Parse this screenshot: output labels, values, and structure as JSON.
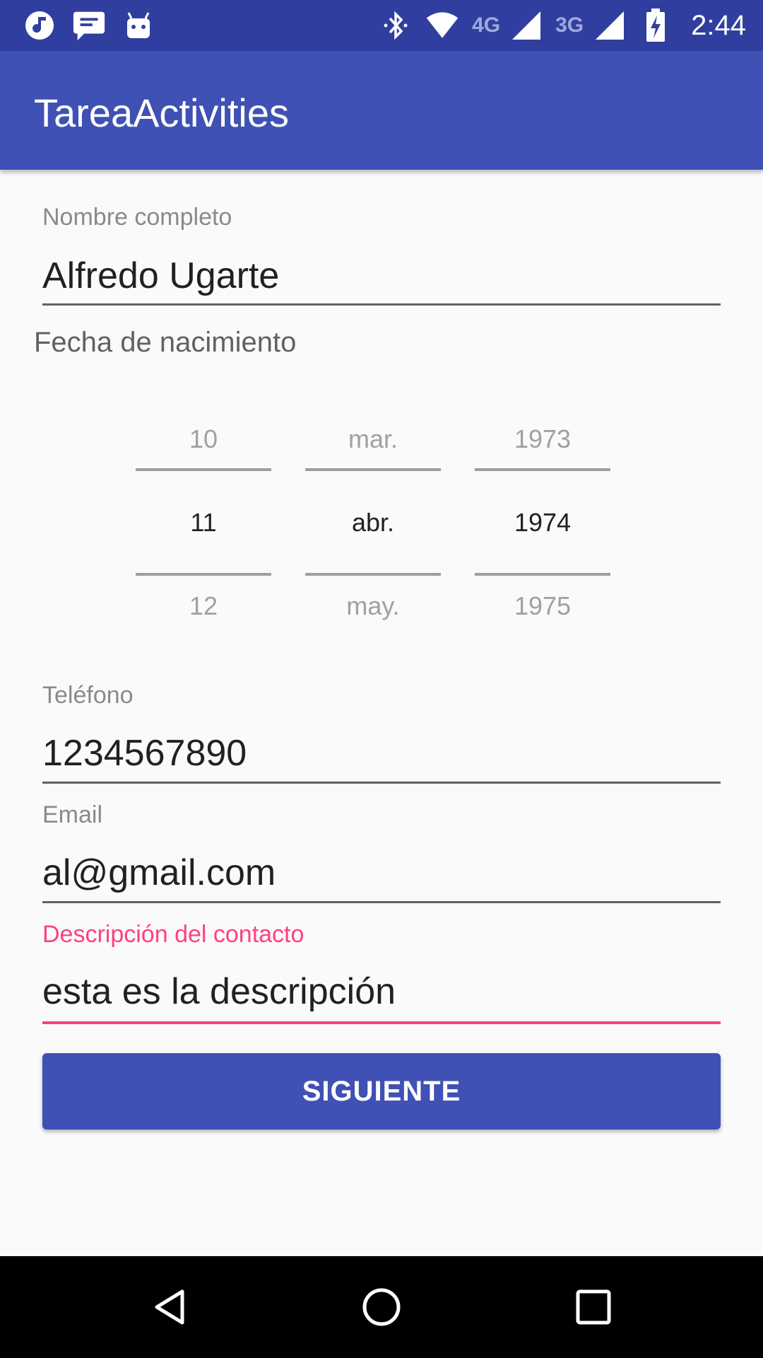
{
  "status_bar": {
    "time": "2:44",
    "network_1": "4G",
    "network_2": "3G",
    "icons": [
      "music-icon",
      "message-icon",
      "android-icon",
      "bluetooth-icon",
      "wifi-icon",
      "signal-icon",
      "battery-charging-icon"
    ]
  },
  "app_bar": {
    "title": "TareaActivities"
  },
  "form": {
    "name": {
      "label": "Nombre completo",
      "value": "Alfredo Ugarte"
    },
    "birth_date": {
      "label": "Fecha de nacimiento",
      "day": {
        "prev": "10",
        "selected": "11",
        "next": "12"
      },
      "month": {
        "prev": "mar.",
        "selected": "abr.",
        "next": "may."
      },
      "year": {
        "prev": "1973",
        "selected": "1974",
        "next": "1975"
      }
    },
    "phone": {
      "label": "Teléfono",
      "value": "1234567890"
    },
    "email": {
      "label": "Email",
      "value": "al@gmail.com"
    },
    "description": {
      "label": "Descripción del contacto",
      "value": "esta es la descripción"
    },
    "next_button": "SIGUIENTE"
  },
  "colors": {
    "status_bar": "#303f9f",
    "primary": "#3f51b5",
    "accent": "#ff4081",
    "background": "#fafafa"
  },
  "nav_bar": {
    "icons": [
      "back-icon",
      "home-icon",
      "recents-icon"
    ]
  }
}
